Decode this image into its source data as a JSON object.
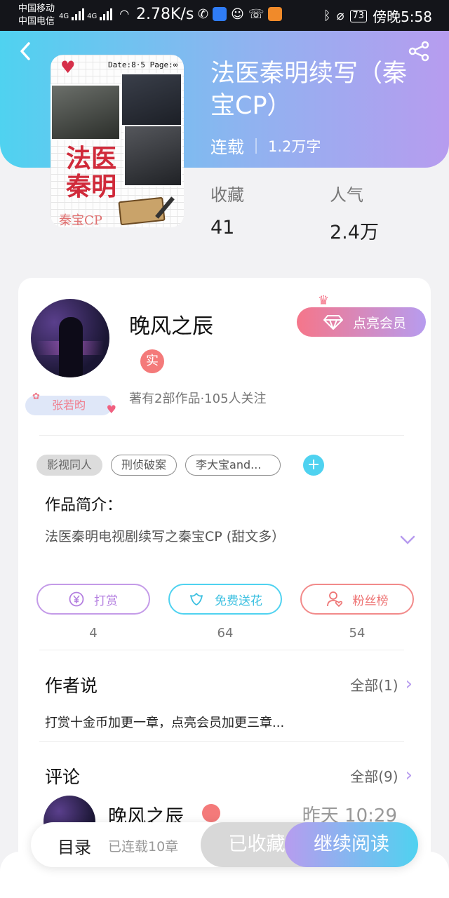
{
  "status_bar": {
    "carrier1": "中国移动",
    "carrier2": "中国电信",
    "net1": "4G",
    "net2": "4G",
    "speed": "2.78K/s",
    "battery": "73",
    "time": "傍晚5:58"
  },
  "book": {
    "title": "法医秦明续写（秦宝CP）",
    "status": "连载",
    "word_count": "1.2万字",
    "cover": {
      "date_text": "Date:8·5 Page:∞",
      "title_big": "法医秦明",
      "title_small": "秦宝CP"
    }
  },
  "stats": {
    "favorites_label": "收藏",
    "favorites_value": "41",
    "popularity_label": "人气",
    "popularity_value": "2.4万"
  },
  "author": {
    "name": "晚风之辰",
    "real_badge": "实",
    "pendant": "张若昀",
    "stats": "著有2部作品·105人关注",
    "vip_button": "点亮会员"
  },
  "tags": [
    "影视同人",
    "刑侦破案",
    "李大宝and..."
  ],
  "intro": {
    "title": "作品简介：",
    "text": "法医秦明电视剧续写之秦宝CP (甜文多）"
  },
  "actions": [
    {
      "label": "打赏",
      "count": "4"
    },
    {
      "label": "免费送花",
      "count": "64"
    },
    {
      "label": "粉丝榜",
      "count": "54"
    }
  ],
  "author_says": {
    "title": "作者说",
    "more": "全部(1)",
    "text": "打赏十金币加更一章，点亮会员加更三章..."
  },
  "comments": {
    "title": "评论",
    "more": "全部(9)",
    "first": {
      "name": "晚风之辰",
      "time": "昨天 10:29"
    }
  },
  "bottom": {
    "toc": "目录",
    "chapters": "已连载10章",
    "collected": "已收藏",
    "continue": "继续阅读"
  },
  "colors": {
    "gradient_start": "#4fd2f0",
    "gradient_end": "#b79cef",
    "pink": "#f5768a"
  },
  "icons": [
    "back-icon",
    "share-icon",
    "diamond-icon",
    "crown-icon",
    "yen-icon",
    "flower-icon",
    "fans-icon",
    "chevron-down-icon",
    "chevron-right-icon",
    "plus-icon"
  ]
}
